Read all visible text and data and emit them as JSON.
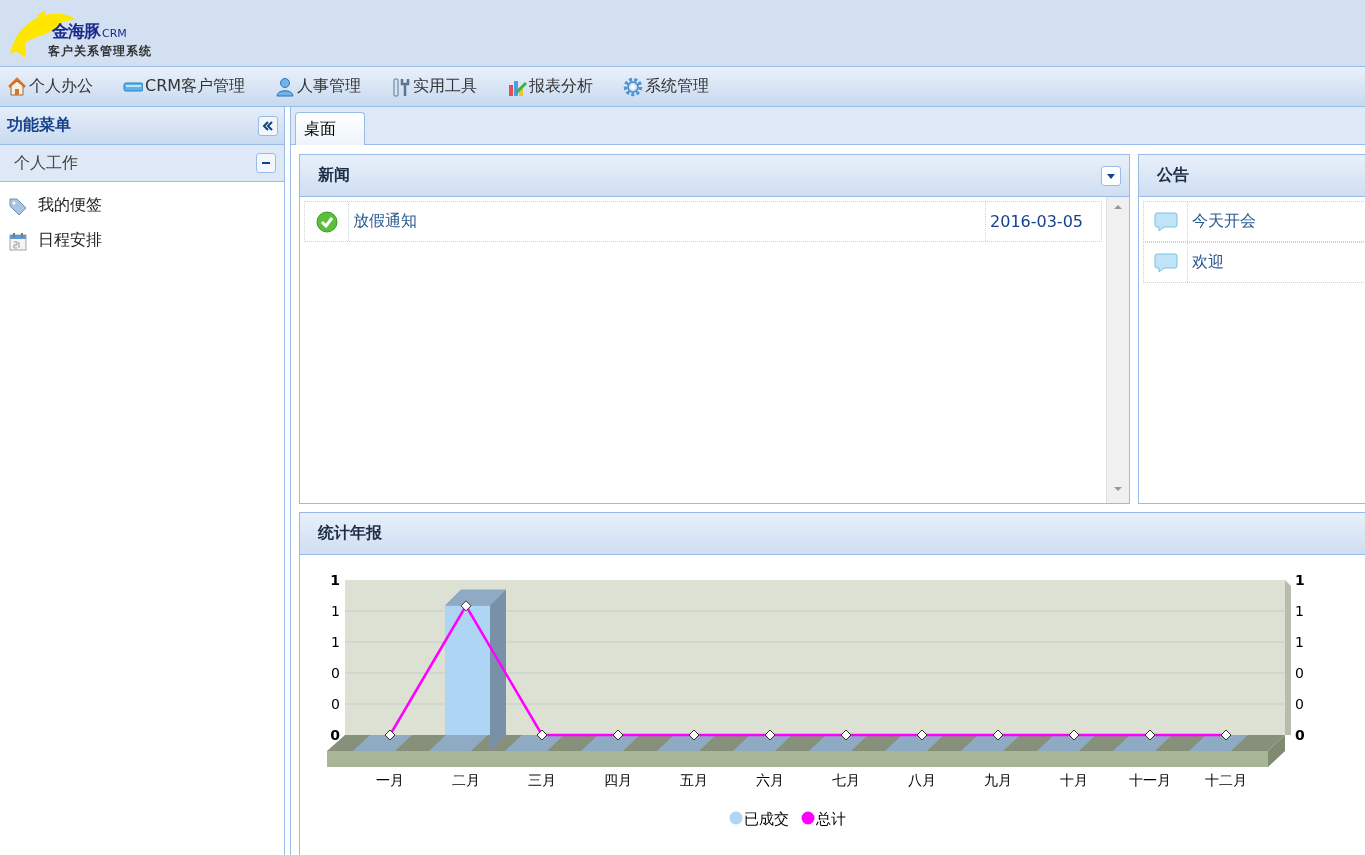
{
  "header": {
    "logo_brand": "金海豚",
    "logo_suffix": "CRM",
    "logo_subtitle": "客户关系管理系统"
  },
  "menu": [
    {
      "label": "个人办公",
      "kind": "house"
    },
    {
      "label": "CRM客户管理",
      "kind": "card"
    },
    {
      "label": "人事管理",
      "kind": "person"
    },
    {
      "label": "实用工具",
      "kind": "tools"
    },
    {
      "label": "报表分析",
      "kind": "chart"
    },
    {
      "label": "系统管理",
      "kind": "gear"
    }
  ],
  "sidebar": {
    "title": "功能菜单",
    "section": {
      "title": "个人工作",
      "expanded": true,
      "items": [
        {
          "label": "我的便签",
          "kind": "tag"
        },
        {
          "label": "日程安排",
          "kind": "calendar"
        }
      ]
    }
  },
  "tabs": [
    {
      "label": "桌面",
      "selected": true
    }
  ],
  "news": {
    "title": "新闻",
    "rows": [
      {
        "title": "放假通知",
        "date": "2016-03-05"
      }
    ]
  },
  "notices": {
    "title": "公告",
    "rows": [
      {
        "title": "今天开会"
      },
      {
        "title": "欢迎"
      }
    ]
  },
  "annual": {
    "title": "统计年报",
    "chart_data": {
      "type": "bar",
      "categories": [
        "一月",
        "二月",
        "三月",
        "四月",
        "五月",
        "六月",
        "七月",
        "八月",
        "九月",
        "十月",
        "十一月",
        "十二月"
      ],
      "series": [
        {
          "name": "已成交",
          "color": "#afd5f5",
          "values": [
            0,
            1,
            0,
            0,
            0,
            0,
            0,
            0,
            0,
            0,
            0,
            0
          ]
        },
        {
          "name": "总计",
          "type": "line",
          "marker": "diamond",
          "color": "#ff00ff",
          "values": [
            0,
            1,
            0,
            0,
            0,
            0,
            0,
            0,
            0,
            0,
            0,
            0
          ]
        }
      ],
      "grid": true,
      "legend": true,
      "ylim": [
        0,
        1.2
      ],
      "yticks": [
        {
          "value": 0,
          "label": "0"
        },
        {
          "value": 0.24,
          "label": "0"
        },
        {
          "value": 0.48,
          "label": "0"
        },
        {
          "value": 0.72,
          "label": "1"
        },
        {
          "value": 0.96,
          "label": "1"
        },
        {
          "value": 1.2,
          "label": "1"
        }
      ]
    }
  }
}
